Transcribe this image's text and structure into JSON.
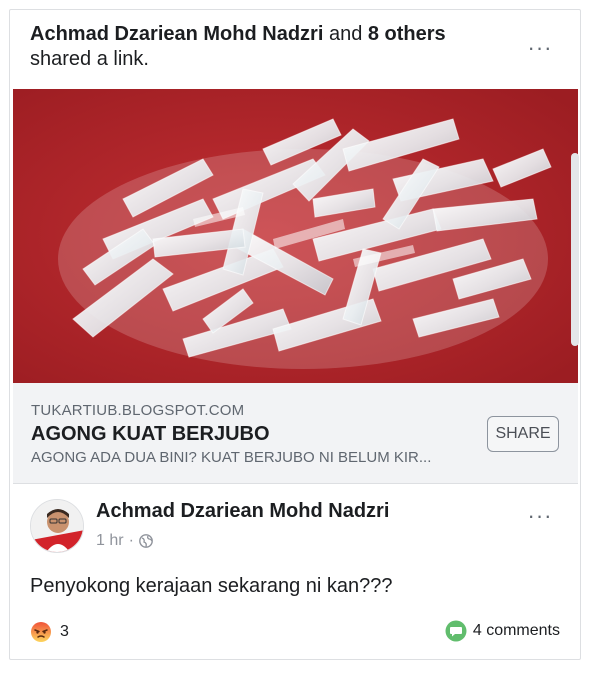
{
  "shared_header": {
    "actor": "Achmad Dzariean Mohd Nadzri",
    "conjunction": " and ",
    "others": "8 others",
    "action": "shared a link."
  },
  "link_preview": {
    "domain": "TUKARTIUB.BLOGSPOT.COM",
    "title": "AGONG KUAT BERJUBO",
    "description": "AGONG ADA DUA BINI? KUAT BERJUBO NI BELUM KIR...",
    "share_label": "SHARE"
  },
  "post": {
    "author": "Achmad Dzariean Mohd Nadzri",
    "time": "1 hr",
    "separator": "·",
    "privacy_icon": "globe-icon",
    "text": "Penyokong kerajaan sekarang ni kan???",
    "reaction_icon": "angry-reaction-icon",
    "reaction_count": "3",
    "comment_icon": "comment-bubble-icon",
    "comments_label": "4 comments"
  },
  "more_label": "···",
  "colors": {
    "image_background": "#b3262b",
    "comment_icon": "#61bd6d",
    "angry_top": "#f0533a",
    "angry_bottom": "#fdd65e",
    "link_box": "#f2f3f5"
  }
}
